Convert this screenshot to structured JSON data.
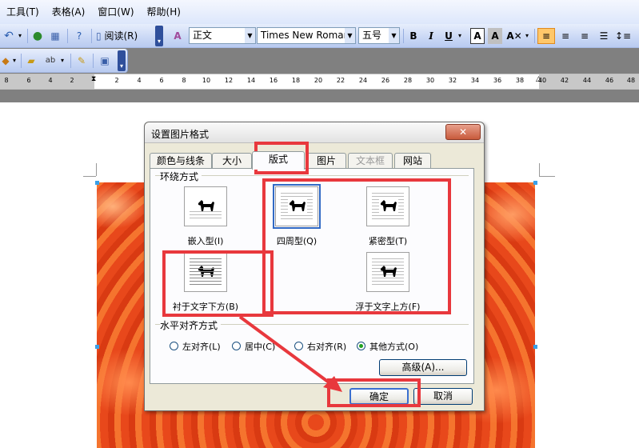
{
  "menubar": {
    "items": [
      "工具(T)",
      "表格(A)",
      "窗口(W)",
      "帮助(H)"
    ]
  },
  "toolbar": {
    "read_label": "阅读(R)",
    "style_value": "正文",
    "font_value": "Times New Roman",
    "size_value": "五号",
    "bold": "B",
    "italic": "I",
    "underline": "U",
    "font_color_a": "A",
    "highlight_a": "A"
  },
  "ruler": {
    "ticks": [
      "8",
      "6",
      "4",
      "2",
      "2",
      "4",
      "6",
      "8",
      "10",
      "12",
      "14",
      "16",
      "18",
      "20",
      "22",
      "24",
      "26",
      "28",
      "30",
      "32",
      "34",
      "36",
      "38",
      "40",
      "42",
      "44",
      "46",
      "48"
    ]
  },
  "dialog": {
    "title": "设置图片格式",
    "close": "✕",
    "tabs": [
      "颜色与线条",
      "大小",
      "版式",
      "图片",
      "文本框",
      "网站"
    ],
    "wrap_group": "环绕方式",
    "wrap_options": [
      "嵌入型(I)",
      "四周型(Q)",
      "紧密型(T)",
      "衬于文字下方(B)",
      "浮于文字上方(F)"
    ],
    "align_group": "水平对齐方式",
    "align_options": [
      "左对齐(L)",
      "居中(C)",
      "右对齐(R)",
      "其他方式(O)"
    ],
    "advanced": "高级(A)...",
    "ok": "确定",
    "cancel": "取消"
  },
  "colors": {
    "highlight": "#e8383d",
    "selection": "#316ac5"
  }
}
